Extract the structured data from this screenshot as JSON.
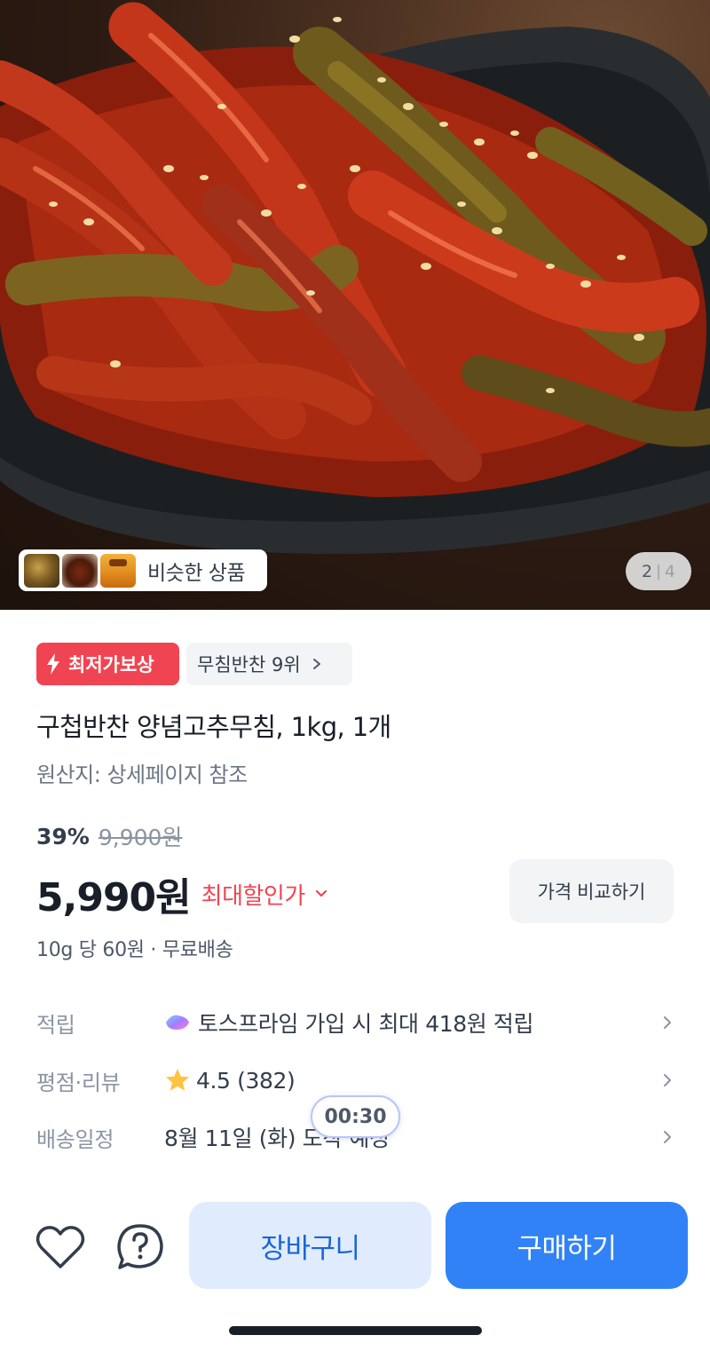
{
  "gallery": {
    "current_page": "2",
    "separator": "|",
    "total_pages": "4",
    "similar_products_label": "비슷한 상품"
  },
  "badges": {
    "lowest_price_label": "최저가보상",
    "ranking_label": "무침반찬 9위"
  },
  "product": {
    "title": "구첩반찬 양념고추무침, 1kg, 1개",
    "origin": "원산지: 상세페이지 참조"
  },
  "pricing": {
    "discount_percent": "39%",
    "original_price": "9,900원",
    "price": "5,990원",
    "max_discount_label": "최대할인가",
    "compare_button_label": "가격 비교하기",
    "unit_price_shipping": "10g 당 60원 · 무료배송"
  },
  "info": {
    "points_key": "적립",
    "points_value": "토스프라임 가입 시 최대 418원 적립",
    "rating_key": "평점·리뷰",
    "rating_value": "4.5 (382)",
    "delivery_key": "배송일정",
    "delivery_value": "8월 11일 (화) 도착 예정"
  },
  "timer": {
    "value": "00:30"
  },
  "bottom_bar": {
    "cart_label": "장바구니",
    "buy_label": "구매하기"
  },
  "colors": {
    "primary_blue": "#3182f6",
    "light_blue": "#e0ecfd",
    "accent_red": "#f04452",
    "star_yellow": "#ffc342"
  }
}
